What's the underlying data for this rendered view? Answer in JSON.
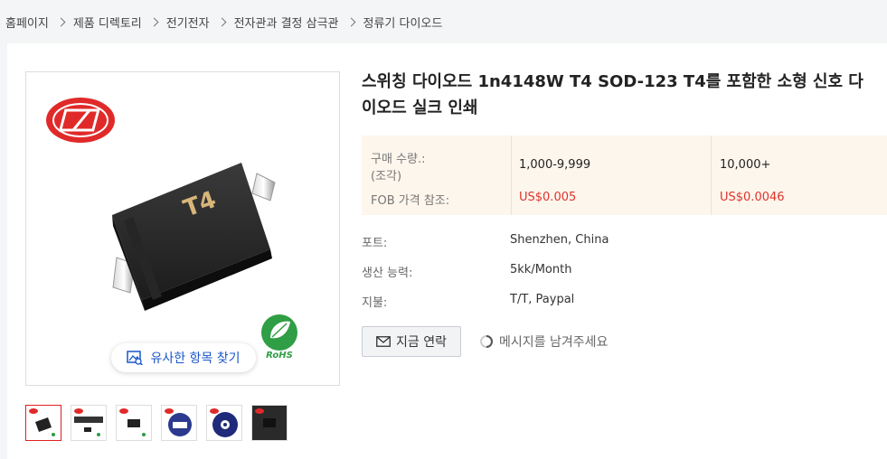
{
  "breadcrumb": [
    "홈페이지",
    "제품 디렉토리",
    "전기전자",
    "전자관과 결정 삼극관",
    "정류기 다이오드"
  ],
  "product": {
    "title": "스위칭 다이오드 1n4148W T4 SOD-123 T4를 포함한 소형 신호 다이오드 실크 인쇄",
    "chip_marking": "T4",
    "rohs_label": "RoHS"
  },
  "similar_button": "유사한 항목 찾기",
  "thumbnails": [
    "thumb-1",
    "thumb-2",
    "thumb-3",
    "thumb-4",
    "thumb-5",
    "thumb-6"
  ],
  "pricing": {
    "qty_label": "구매 수량.:",
    "qty_unit": "(조각)",
    "fob_label": "FOB 가격 참조:",
    "tiers": [
      {
        "qty": "1,000-9,999",
        "price": "US$0.005"
      },
      {
        "qty": "10,000+",
        "price": "US$0.0046"
      }
    ]
  },
  "info": [
    {
      "label": "포트:",
      "value": "Shenzhen, China"
    },
    {
      "label": "생산 능력:",
      "value": "5kk/Month"
    },
    {
      "label": "지불:",
      "value": "T/T, Paypal"
    }
  ],
  "actions": {
    "contact": "지금 연락",
    "leave_message": "메시지를 남겨주세요"
  },
  "colors": {
    "accent_red": "#e0322c",
    "link_blue": "#1a56c8",
    "price_bg": "#fdf6ec",
    "logo_red": "#e02a2a"
  }
}
